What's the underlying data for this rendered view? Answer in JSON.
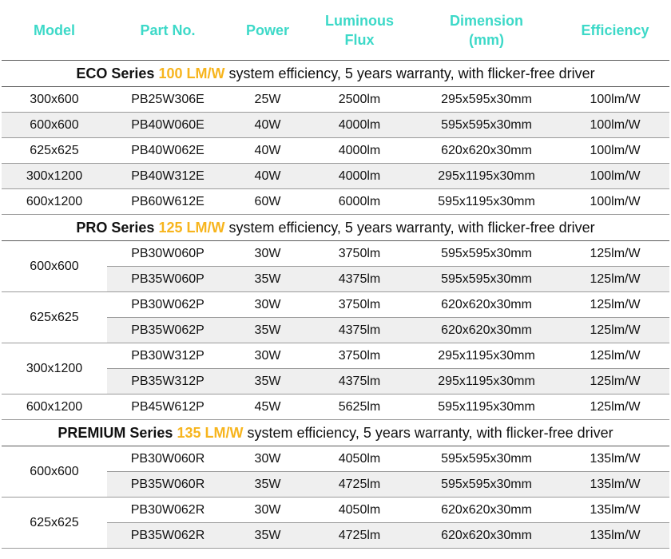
{
  "headers": {
    "model": "Model",
    "part": "Part No.",
    "power": "Power",
    "flux_1": "Luminous",
    "flux_2": "Flux",
    "dim_1": "Dimension",
    "dim_2": "(mm)",
    "efficiency": "Efficiency"
  },
  "colors": {
    "header_text": "#3dd9c8",
    "series_efficiency": "#f7b51e",
    "alt_row_bg": "#efefef"
  },
  "series": [
    {
      "name": "ECO Series",
      "efficiency": "100 LM/W",
      "description": "system efficiency, 5 years warranty, with flicker-free driver",
      "rows": [
        {
          "model": "300x600",
          "part": "PB25W306E",
          "power": "25W",
          "flux": "2500lm",
          "dim": "295x595x30mm",
          "eff": "100lm/W"
        },
        {
          "model": "600x600",
          "part": "PB40W060E",
          "power": "40W",
          "flux": "4000lm",
          "dim": "595x595x30mm",
          "eff": "100lm/W"
        },
        {
          "model": "625x625",
          "part": "PB40W062E",
          "power": "40W",
          "flux": "4000lm",
          "dim": "620x620x30mm",
          "eff": "100lm/W"
        },
        {
          "model": "300x1200",
          "part": "PB40W312E",
          "power": "40W",
          "flux": "4000lm",
          "dim": "295x1195x30mm",
          "eff": "100lm/W"
        },
        {
          "model": "600x1200",
          "part": "PB60W612E",
          "power": "60W",
          "flux": "6000lm",
          "dim": "595x1195x30mm",
          "eff": "100lm/W"
        }
      ]
    },
    {
      "name": "PRO Series",
      "efficiency": "125 LM/W",
      "description": "system efficiency, 5 years warranty, with flicker-free driver",
      "rows": [
        {
          "model": "600x600",
          "part": "PB30W060P",
          "power": "30W",
          "flux": "3750lm",
          "dim": "595x595x30mm",
          "eff": "125lm/W"
        },
        {
          "model": "",
          "part": "PB35W060P",
          "power": "35W",
          "flux": "4375lm",
          "dim": "595x595x30mm",
          "eff": "125lm/W"
        },
        {
          "model": "625x625",
          "part": "PB30W062P",
          "power": "30W",
          "flux": "3750lm",
          "dim": "620x620x30mm",
          "eff": "125lm/W"
        },
        {
          "model": "",
          "part": "PB35W062P",
          "power": "35W",
          "flux": "4375lm",
          "dim": "620x620x30mm",
          "eff": "125lm/W"
        },
        {
          "model": "300x1200",
          "part": "PB30W312P",
          "power": "30W",
          "flux": "3750lm",
          "dim": "295x1195x30mm",
          "eff": "125lm/W"
        },
        {
          "model": "",
          "part": "PB35W312P",
          "power": "35W",
          "flux": "4375lm",
          "dim": "295x1195x30mm",
          "eff": "125lm/W"
        },
        {
          "model": "600x1200",
          "part": "PB45W612P",
          "power": "45W",
          "flux": "5625lm",
          "dim": "595x1195x30mm",
          "eff": "125lm/W"
        }
      ]
    },
    {
      "name": "PREMIUM Series",
      "efficiency": "135 LM/W",
      "description": "system efficiency, 5 years warranty, with flicker-free driver",
      "rows": [
        {
          "model": "600x600",
          "part": "PB30W060R",
          "power": "30W",
          "flux": "4050lm",
          "dim": "595x595x30mm",
          "eff": "135lm/W"
        },
        {
          "model": "",
          "part": "PB35W060R",
          "power": "35W",
          "flux": "4725lm",
          "dim": "595x595x30mm",
          "eff": "135lm/W"
        },
        {
          "model": "625x625",
          "part": "PB30W062R",
          "power": "30W",
          "flux": "4050lm",
          "dim": "620x620x30mm",
          "eff": "135lm/W"
        },
        {
          "model": "",
          "part": "PB35W062R",
          "power": "35W",
          "flux": "4725lm",
          "dim": "620x620x30mm",
          "eff": "135lm/W"
        }
      ]
    }
  ]
}
